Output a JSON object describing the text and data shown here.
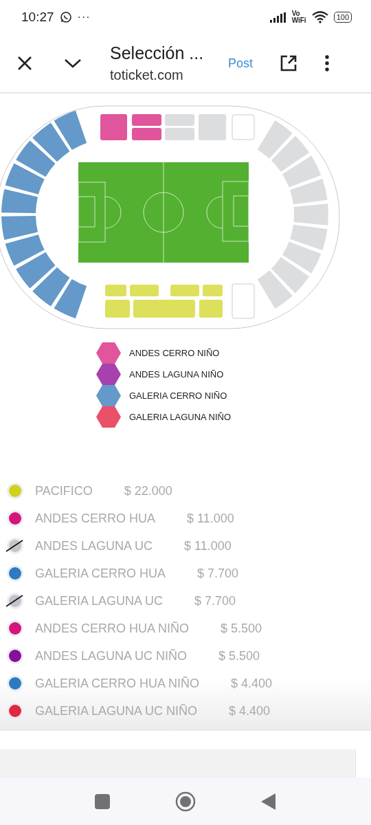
{
  "status_bar": {
    "time": "10:27",
    "more": "···",
    "network_top": "Vo",
    "network_bottom": "WiFi",
    "battery": "100"
  },
  "toolbar": {
    "title": "Selección ...",
    "url": "toticket.com",
    "action": "Post"
  },
  "legend": [
    {
      "label": "ANDES CERRO NIÑO",
      "color": "#e0559c"
    },
    {
      "label": "ANDES LAGUNA NIÑO",
      "color": "#a641ad"
    },
    {
      "label": "GALERIA CERRO NIÑO",
      "color": "#6499c9"
    },
    {
      "label": "GALERIA LAGUNA NIÑO",
      "color": "#ea5068"
    }
  ],
  "prices": [
    {
      "name": "PACIFICO",
      "price": "$ 22.000",
      "color": "#cfd11c",
      "sold_out": false
    },
    {
      "name": "ANDES CERRO HUA",
      "price": "$ 11.000",
      "color": "#d4157a",
      "sold_out": false
    },
    {
      "name": "ANDES LAGUNA UC",
      "price": "$ 11.000",
      "color": "#c4c4c8",
      "sold_out": true
    },
    {
      "name": "GALERIA CERRO HUA",
      "price": "$ 7.700",
      "color": "#2e7ac2",
      "sold_out": false
    },
    {
      "name": "GALERIA LAGUNA UC",
      "price": "$ 7.700",
      "color": "#c4c4c8",
      "sold_out": true
    },
    {
      "name": "ANDES CERRO HUA NIÑO",
      "price": "$ 5.500",
      "color": "#d4157a",
      "sold_out": false
    },
    {
      "name": "ANDES LAGUNA UC NIÑO",
      "price": "$ 5.500",
      "color": "#860f9c",
      "sold_out": false
    },
    {
      "name": "GALERIA CERRO HUA NIÑO",
      "price": "$ 4.400",
      "color": "#2e7ac2",
      "sold_out": false
    },
    {
      "name": "GALERIA LAGUNA UC NIÑO",
      "price": "$ 4.400",
      "color": "#e0283f",
      "sold_out": false
    }
  ]
}
